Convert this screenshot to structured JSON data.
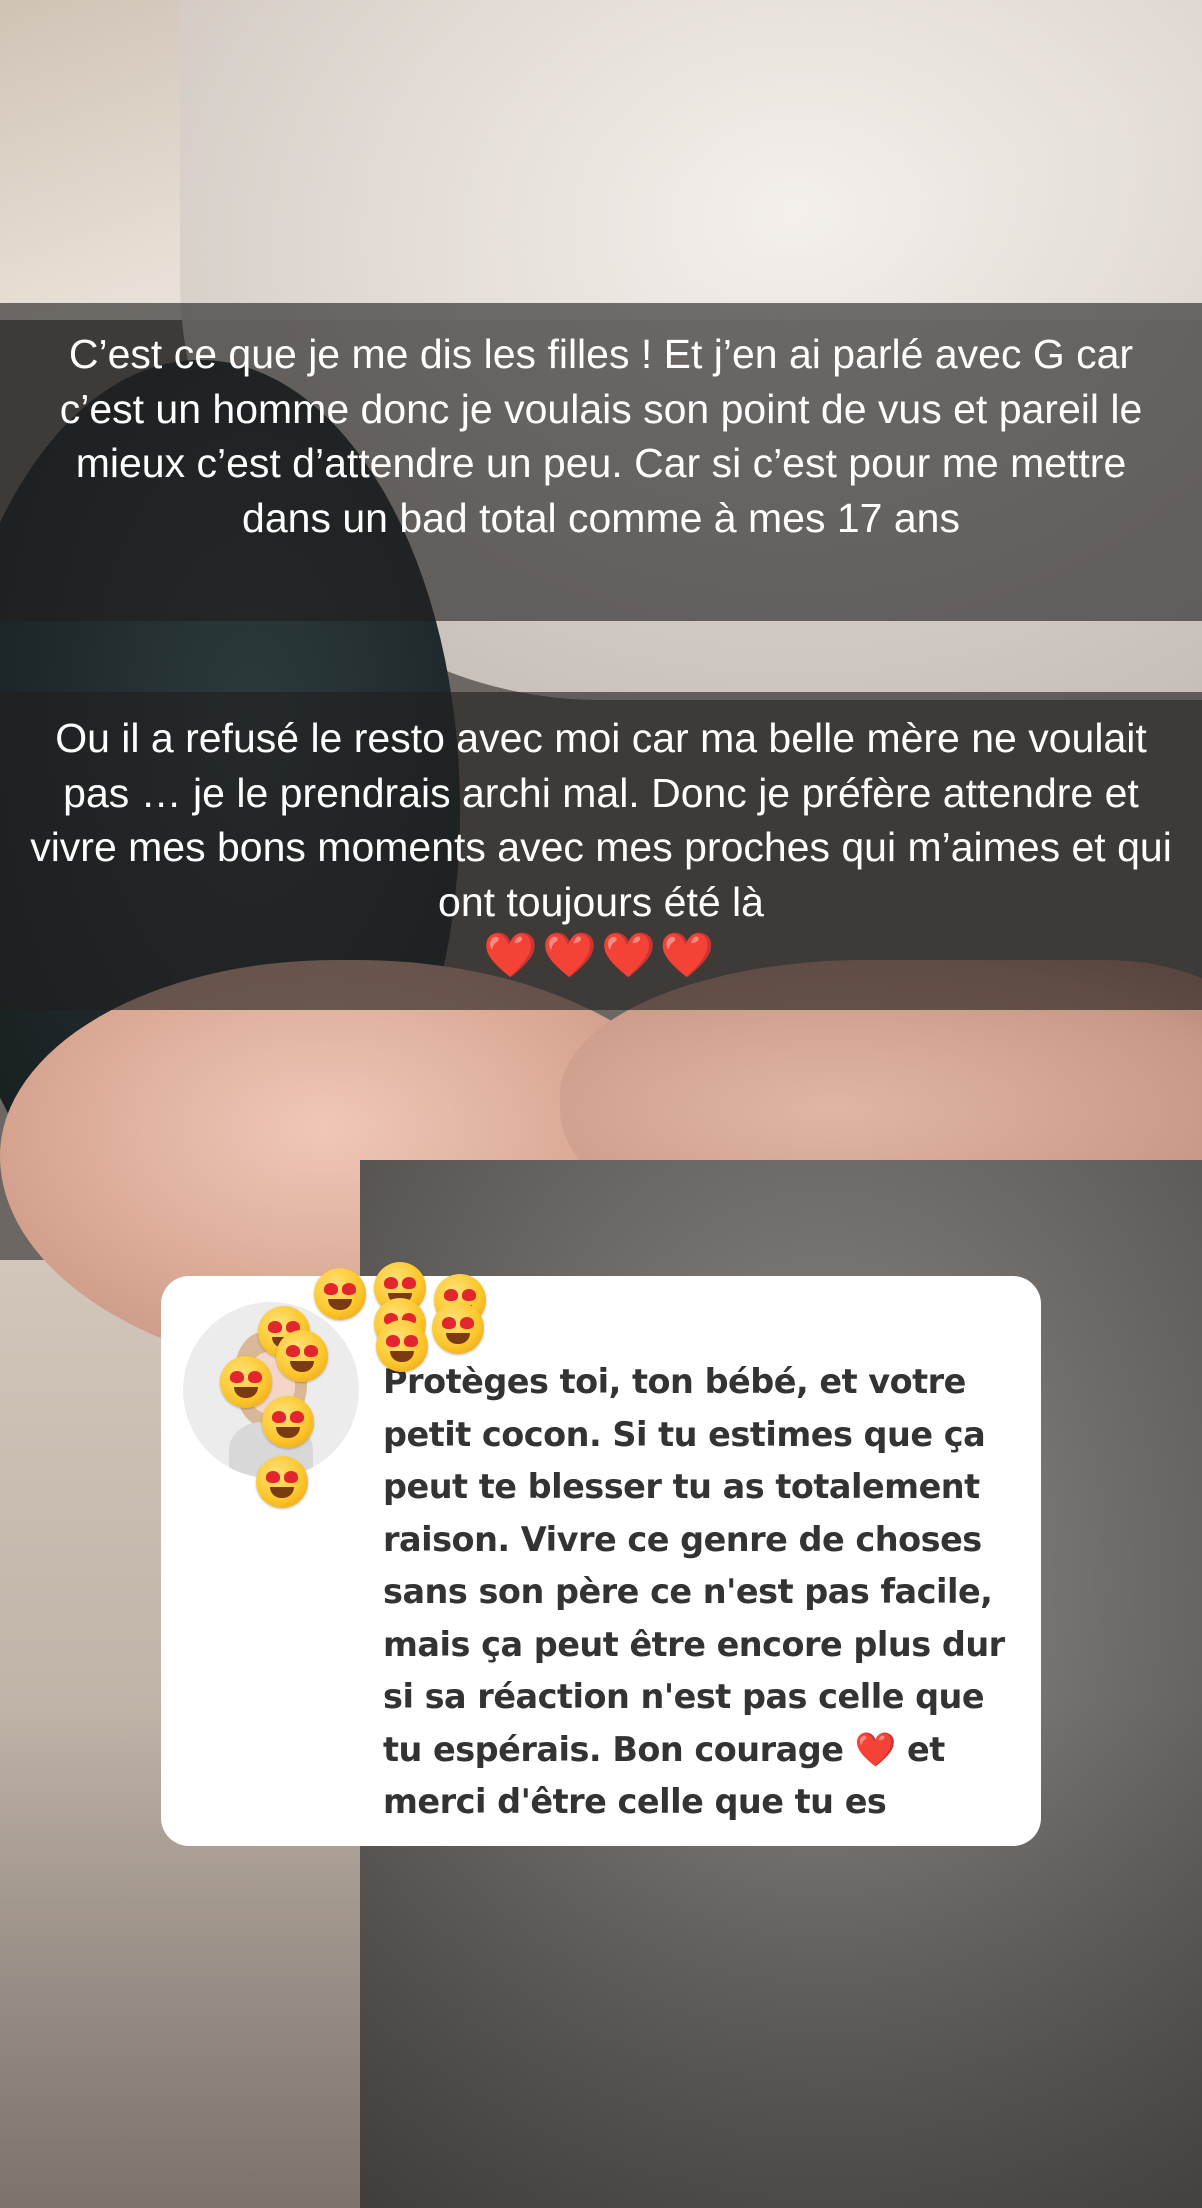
{
  "caption_1": {
    "text": "C’est ce que je me dis les filles ! Et j’en ai parlé avec G car c’est un homme donc je voulais son point de vus et pareil le mieux c’est d’attendre un peu. Car si c’est pour me mettre dans un bad total comme à mes 17 ans"
  },
  "caption_2": {
    "text": "Ou il a refusé le resto avec moi car ma belle mère ne voulait pas … je le prendrais archi mal. Donc je préfère attendre et vivre mes bons moments avec mes proches qui m’aimes et qui ont toujours été là",
    "hearts": "❤️❤️❤️❤️"
  },
  "reply": {
    "text_before_heart": "Protèges toi, ton bébé, et votre petit cocon. Si tu estimes que ça peut te blesser tu as totalement raison. Vivre ce genre de choses sans son père ce n'est pas facile, mais ça peut être encore plus dur si sa réaction n'est pas celle que tu espérais. Bon courage",
    "heart": "❤️",
    "text_after_heart": "et merci d'être celle que tu es"
  },
  "stickers": {
    "emoji_name": "heart-eyes-emoji",
    "count": 11
  }
}
